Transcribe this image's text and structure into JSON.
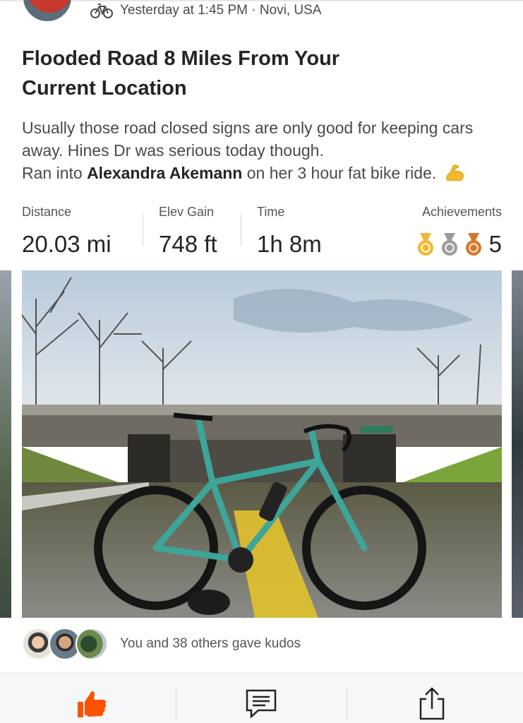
{
  "activity": {
    "meta": "Yesterday at 1:45 PM · Novi, USA",
    "sport_icon": "bike-icon",
    "title": "Flooded Road 8 Miles From Your Current Location",
    "description_line1": "Usually those road closed signs are only good for keeping cars away. Hines Dr was serious today though.",
    "description_line2_prefix": "Ran into ",
    "description_line2_name": "Alexandra Akemann",
    "description_line2_suffix": " on her 3 hour fat bike ride.",
    "description_emoji": "flexed-biceps-icon"
  },
  "stats": [
    {
      "label": "Distance",
      "value": "20.03 mi"
    },
    {
      "label": "Elev Gain",
      "value": "748 ft"
    },
    {
      "label": "Time",
      "value": "1h 8m"
    }
  ],
  "achievements": {
    "label": "Achievements",
    "count": "5",
    "medals": [
      "gold",
      "silver",
      "bronze"
    ],
    "colors": {
      "gold": "#f2b632",
      "silver": "#9a9a9f",
      "bronze": "#d3772f"
    }
  },
  "photo": {
    "icon": "photo-bike-flooded-road"
  },
  "kudos": {
    "text": "You and 38 others gave kudos"
  },
  "actions": {
    "kudos_icon": "thumbs-up-icon",
    "comment_icon": "comment-icon",
    "share_icon": "share-icon",
    "accent": "#fc5200"
  }
}
